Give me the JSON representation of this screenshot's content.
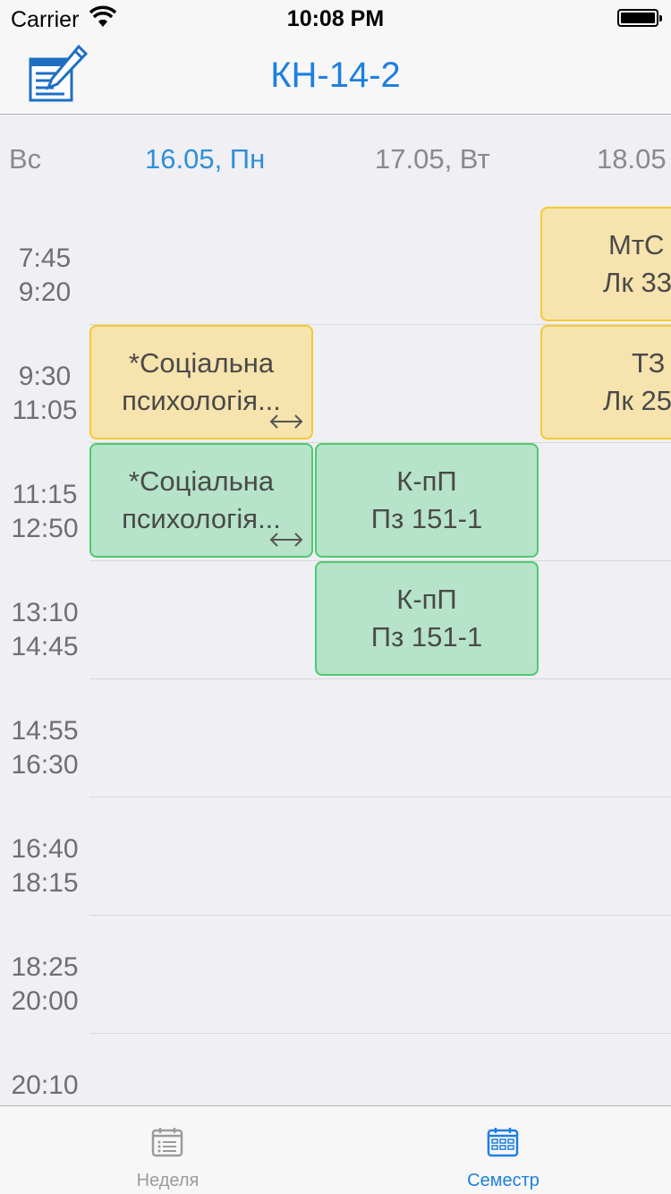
{
  "status_bar": {
    "carrier": "Carrier",
    "time": "10:08 PM"
  },
  "nav": {
    "title": "КН-14-2",
    "edit_icon": "edit-document-icon"
  },
  "days": [
    "Вс",
    "16.05, Пн",
    "17.05, Вт",
    "18.05"
  ],
  "times": [
    [
      "7:45",
      "9:20"
    ],
    [
      "9:30",
      "11:05"
    ],
    [
      "11:15",
      "12:50"
    ],
    [
      "13:10",
      "14:45"
    ],
    [
      "14:55",
      "16:30"
    ],
    [
      "16:40",
      "18:15"
    ],
    [
      "18:25",
      "20:00"
    ],
    [
      "20:10",
      ""
    ]
  ],
  "lessons": [
    {
      "line1": "МтС",
      "line2": "Лк 33",
      "type": "lecture"
    },
    {
      "line1": "*Соціальна",
      "line2": "психологія...",
      "type": "lecture",
      "arrow": "double-arrow-icon"
    },
    {
      "line1": "ТЗ",
      "line2": "Лк 25",
      "type": "lecture"
    },
    {
      "line1": "*Соціальна",
      "line2": "психологія...",
      "type": "practice",
      "arrow": "double-arrow-icon"
    },
    {
      "line1": "К-пП",
      "line2": "Пз 151-1",
      "type": "practice"
    },
    {
      "line1": "К-пП",
      "line2": "Пз 151-1",
      "type": "practice"
    }
  ],
  "tabs": [
    {
      "label": "Неделя",
      "icon": "list-icon",
      "active": false
    },
    {
      "label": "Семестр",
      "icon": "calendar-icon",
      "active": true
    }
  ],
  "colors": {
    "accent": "#1e7fe0",
    "lecture_bg": "#f6e3ad",
    "lecture_border": "#f4cb30",
    "practice_bg": "#b6e3ca",
    "practice_border": "#4ccb6e",
    "inactive_tab": "#9b9b9b"
  }
}
